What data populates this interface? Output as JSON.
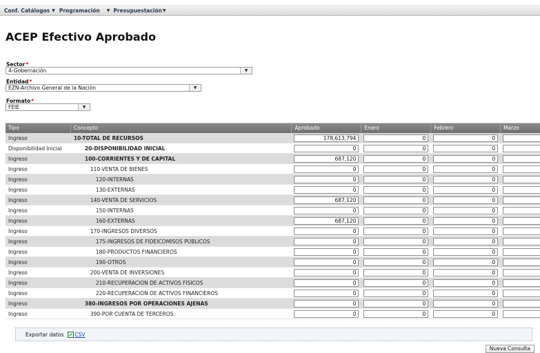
{
  "menu": {
    "items": [
      {
        "label": "Conf. Catálogos"
      },
      {
        "label": "Programación"
      },
      {
        "label": "Presupuestación"
      }
    ]
  },
  "page": {
    "title": "ACEP Efectivo Aprobado"
  },
  "form": {
    "sector": {
      "label": "Sector",
      "value": "4-Gobernación"
    },
    "entidad": {
      "label": "Entidad",
      "value": "EZN-Archivo General de la Nación"
    },
    "formato": {
      "label": "Formato",
      "value": "FEIE"
    },
    "required_mark": "*"
  },
  "grid": {
    "headers": [
      "Tipo",
      "Concepto",
      "Aprobado",
      "Enero",
      "Febrero",
      "Marzo"
    ],
    "rows": [
      {
        "tipo": "Ingreso",
        "concepto": "10-TOTAL DE RECURSOS",
        "indent": 0,
        "bold": true,
        "aprobado": "178,613,794",
        "enero": "0",
        "febrero": "0"
      },
      {
        "tipo": "Disponibilidad Inicial",
        "concepto": "20-DISPONIBILIDAD INICIAL",
        "indent": 1,
        "bold": true,
        "aprobado": "0",
        "enero": "0",
        "febrero": "0"
      },
      {
        "tipo": "Ingreso",
        "concepto": "100-CORRIENTES Y DE CAPITAL",
        "indent": 1,
        "bold": true,
        "aprobado": "687,120",
        "enero": "0",
        "febrero": "0"
      },
      {
        "tipo": "Ingreso",
        "concepto": "110-VENTA DE BIENES",
        "indent": 2,
        "bold": false,
        "aprobado": "0",
        "enero": "0",
        "febrero": "0"
      },
      {
        "tipo": "Ingreso",
        "concepto": "120-INTERNAS",
        "indent": 3,
        "bold": false,
        "aprobado": "0",
        "enero": "0",
        "febrero": "0"
      },
      {
        "tipo": "Ingreso",
        "concepto": "130-EXTERNAS",
        "indent": 3,
        "bold": false,
        "aprobado": "0",
        "enero": "0",
        "febrero": "0"
      },
      {
        "tipo": "Ingreso",
        "concepto": "140-VENTA DE SERVICIOS",
        "indent": 2,
        "bold": false,
        "aprobado": "687,120",
        "enero": "0",
        "febrero": "0"
      },
      {
        "tipo": "Ingreso",
        "concepto": "150-INTERNAS",
        "indent": 3,
        "bold": false,
        "aprobado": "0",
        "enero": "0",
        "febrero": "0"
      },
      {
        "tipo": "Ingreso",
        "concepto": "160-EXTERNAS",
        "indent": 3,
        "bold": false,
        "aprobado": "687,120",
        "enero": "0",
        "febrero": "0"
      },
      {
        "tipo": "Ingreso",
        "concepto": "170-INGRESOS DIVERSOS",
        "indent": 2,
        "bold": false,
        "aprobado": "0",
        "enero": "0",
        "febrero": "0"
      },
      {
        "tipo": "Ingreso",
        "concepto": "175-INGRESOS DE FIDEICOMISOS PÚBLICOS",
        "indent": 3,
        "bold": false,
        "aprobado": "0",
        "enero": "0",
        "febrero": "0"
      },
      {
        "tipo": "Ingreso",
        "concepto": "180-PRODUCTOS FINANCIEROS",
        "indent": 3,
        "bold": false,
        "aprobado": "0",
        "enero": "0",
        "febrero": "0"
      },
      {
        "tipo": "Ingreso",
        "concepto": "190-OTROS",
        "indent": 3,
        "bold": false,
        "aprobado": "0",
        "enero": "0",
        "febrero": "0"
      },
      {
        "tipo": "Ingreso",
        "concepto": "200-VENTA DE INVERSIONES",
        "indent": 2,
        "bold": false,
        "aprobado": "0",
        "enero": "0",
        "febrero": "0"
      },
      {
        "tipo": "Ingreso",
        "concepto": "210-RECUPERACIÓN DE ACTIVOS FÍSICOS",
        "indent": 3,
        "bold": false,
        "aprobado": "0",
        "enero": "0",
        "febrero": "0"
      },
      {
        "tipo": "Ingreso",
        "concepto": "220-RECUPERACIÓN DE ACTIVOS FINANCIEROS",
        "indent": 3,
        "bold": false,
        "aprobado": "0",
        "enero": "0",
        "febrero": "0"
      },
      {
        "tipo": "Ingreso",
        "concepto": "380-INGRESOS POR OPERACIONES AJENAS",
        "indent": 1,
        "bold": true,
        "aprobado": "0",
        "enero": "0",
        "febrero": "0"
      },
      {
        "tipo": "Ingreso",
        "concepto": "390-POR CUENTA DE TERCEROS",
        "indent": 2,
        "bold": false,
        "aprobado": "0",
        "enero": "0",
        "febrero": "0"
      }
    ]
  },
  "export": {
    "label": "Exportar datos",
    "csv_label": "CSV"
  },
  "buttons": {
    "nueva_consulta": "Nueva Consulta"
  }
}
